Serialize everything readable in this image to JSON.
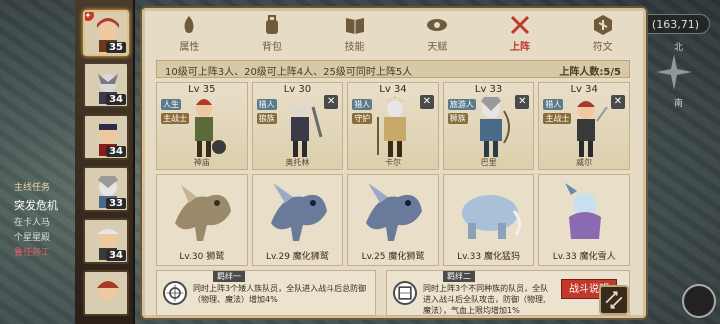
{
  "world": {
    "coordinates": "(163,71)",
    "compass": {
      "north": "北",
      "south": "南"
    },
    "quest": {
      "title": "主线任务",
      "name": "突发危机",
      "line1": "在卡人马",
      "line2": "个星星殿",
      "line3": "鲁任务工"
    }
  },
  "avatars": [
    {
      "level": "35",
      "selected": true
    },
    {
      "level": "34",
      "selected": false
    },
    {
      "level": "34",
      "selected": false
    },
    {
      "level": "33",
      "selected": false
    },
    {
      "level": "34",
      "selected": false
    },
    {
      "level": "",
      "selected": false
    }
  ],
  "tabs": [
    {
      "label": "属性",
      "icon": "attribute-icon",
      "active": false
    },
    {
      "label": "背包",
      "icon": "backpack-icon",
      "active": false
    },
    {
      "label": "技能",
      "icon": "skill-book-icon",
      "active": false
    },
    {
      "label": "天赋",
      "icon": "talent-eye-icon",
      "active": false
    },
    {
      "label": "上阵",
      "icon": "crossed-swords-icon",
      "active": true
    },
    {
      "label": "符文",
      "icon": "rune-icon",
      "active": false
    }
  ],
  "strip": {
    "rule": "10级可上阵3人、20级可上阵4人、25级可同时上阵5人",
    "count": "上阵人数:5/5"
  },
  "units": [
    {
      "level": "Lv 35",
      "tags": [
        "人生",
        "主战士"
      ],
      "name": "神庙",
      "removable": false,
      "beast": "Lv.30 狮鹫",
      "color": "#b03a2a"
    },
    {
      "level": "Lv 30",
      "tags": [
        "猎人",
        "狼族"
      ],
      "name": "奥托林",
      "removable": true,
      "beast": "Lv.29 魔化狮鹫",
      "color": "#8c8c8c"
    },
    {
      "level": "Lv 34",
      "tags": [
        "猎人",
        "守护"
      ],
      "name": "卡尔",
      "removable": true,
      "beast": "Lv.25 魔化狮鹫",
      "color": "#c7a96a"
    },
    {
      "level": "Lv 33",
      "tags": [
        "旅游人",
        "狮族"
      ],
      "name": "巴里",
      "removable": true,
      "beast": "Lv.33 魔化猛犸",
      "color": "#6a8ca8"
    },
    {
      "level": "Lv 34",
      "tags": [
        "猎人",
        "主战士"
      ],
      "name": "威尔",
      "removable": true,
      "beast": "Lv.33 魔化雪人",
      "color": "#a83a2a"
    }
  ],
  "bonds": [
    {
      "title": "羁绊一",
      "desc": "同时上阵3个矮人族队员，全队进入战斗后总防御（物理、魔法）增加4%"
    },
    {
      "title": "羁绊二",
      "desc": "同时上阵3个不同种族的队员，全队进入战斗后全队攻击，防御（物理,魔法），气血上限均增加1%"
    }
  ],
  "battle_button": "战斗说明",
  "colors": {
    "accent": "#c0392b",
    "panel": "#e6dcc6",
    "border": "#6d5636"
  }
}
